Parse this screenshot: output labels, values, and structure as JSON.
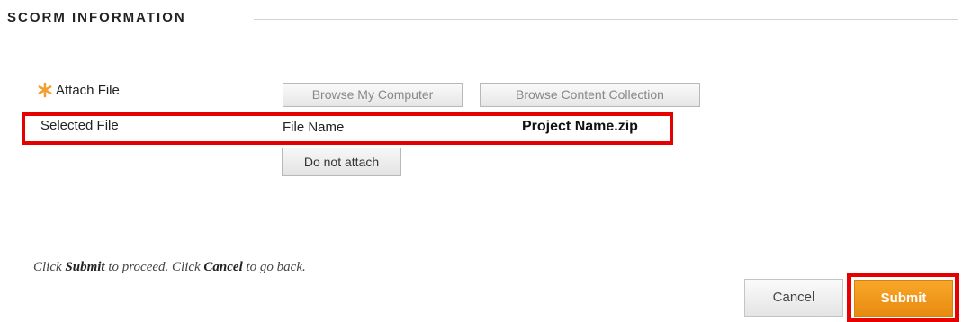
{
  "section": {
    "title": "SCORM INFORMATION"
  },
  "attach": {
    "label": "Attach File",
    "browse_computer_label": "Browse My Computer",
    "browse_collection_label": "Browse Content Collection"
  },
  "selected_file": {
    "label": "Selected File",
    "file_name_label": "File Name",
    "file_name_value": "Project Name.zip",
    "do_not_attach_label": "Do not attach"
  },
  "instructions": {
    "part1": "Click ",
    "submit_word": "Submit",
    "part2": " to proceed. Click ",
    "cancel_word": "Cancel",
    "part3": " to go back."
  },
  "actions": {
    "cancel_label": "Cancel",
    "submit_label": "Submit"
  },
  "colors": {
    "accent_orange": "#f39c1e",
    "highlight_red": "#e60000",
    "required_star": "#f0a030"
  }
}
